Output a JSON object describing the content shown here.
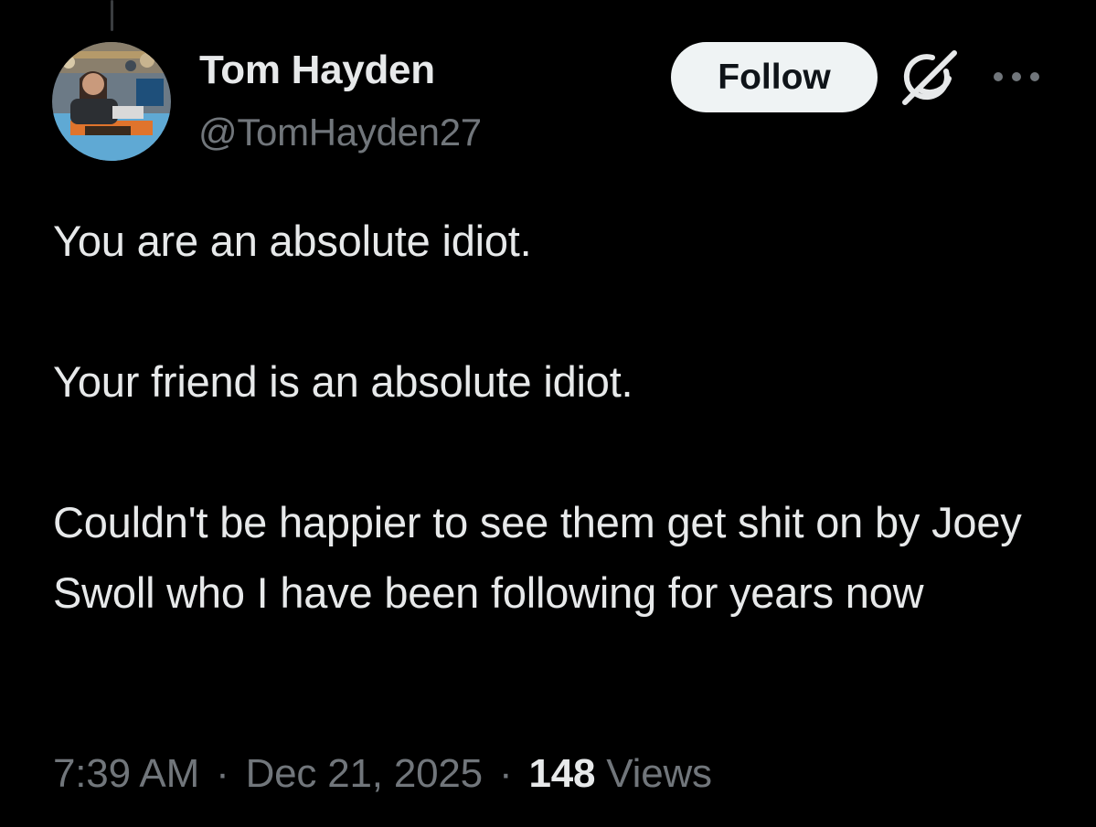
{
  "author": {
    "display_name": "Tom Hayden",
    "handle": "@TomHayden27"
  },
  "actions": {
    "follow_label": "Follow",
    "grok_icon": "grok-icon",
    "more_icon": "more-options-icon"
  },
  "tweet": {
    "paragraphs": [
      "You are an absolute idiot.",
      "Your friend is an absolute idiot.",
      "Couldn't be happier to see them get shit on by Joey Swoll who I have been following for years now"
    ],
    "time": "7:39 AM",
    "separator": "·",
    "date": "Dec 21, 2025",
    "views_count": "148",
    "views_label": "Views"
  },
  "colors": {
    "background": "#000000",
    "primary_text": "#e7e9ea",
    "secondary_text": "#71767b",
    "follow_bg": "#eff3f4",
    "follow_text": "#0f1419"
  }
}
